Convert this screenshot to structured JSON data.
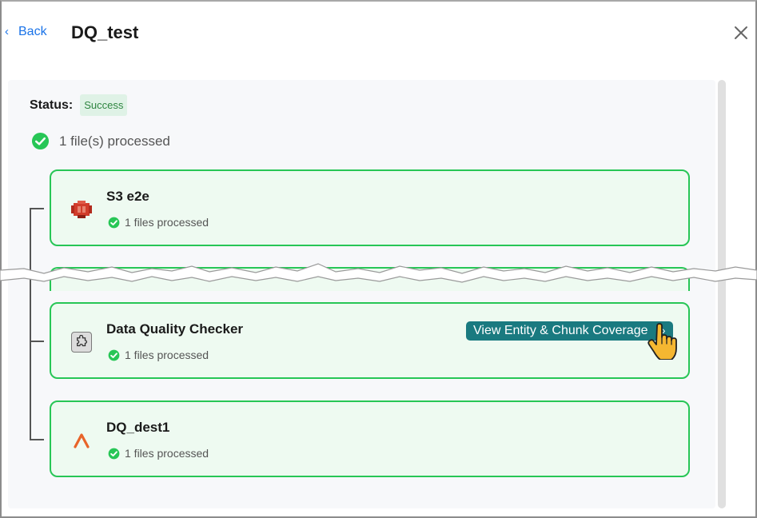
{
  "header": {
    "back_label": "Back",
    "title": "DQ_test"
  },
  "status": {
    "label": "Status:",
    "value": "Success"
  },
  "summary": {
    "processed_text": "1 file(s) processed"
  },
  "pipeline": [
    {
      "name": "S3 e2e",
      "processed": "1 files processed",
      "icon": "aws-s3-icon"
    },
    {
      "name": "Data Quality Checker",
      "processed": "1 files processed",
      "icon": "puzzle-icon",
      "action_label": "View Entity & Chunk Coverage"
    },
    {
      "name": "DQ_dest1",
      "processed": "1 files processed",
      "icon": "caret-logo-icon"
    }
  ],
  "colors": {
    "accent_link": "#1a73e8",
    "success_green": "#27c656",
    "card_bg": "#eefaf1",
    "button_teal": "#1a7a80",
    "destination_orange": "#e8642a",
    "s3_red": "#d13c2b"
  }
}
